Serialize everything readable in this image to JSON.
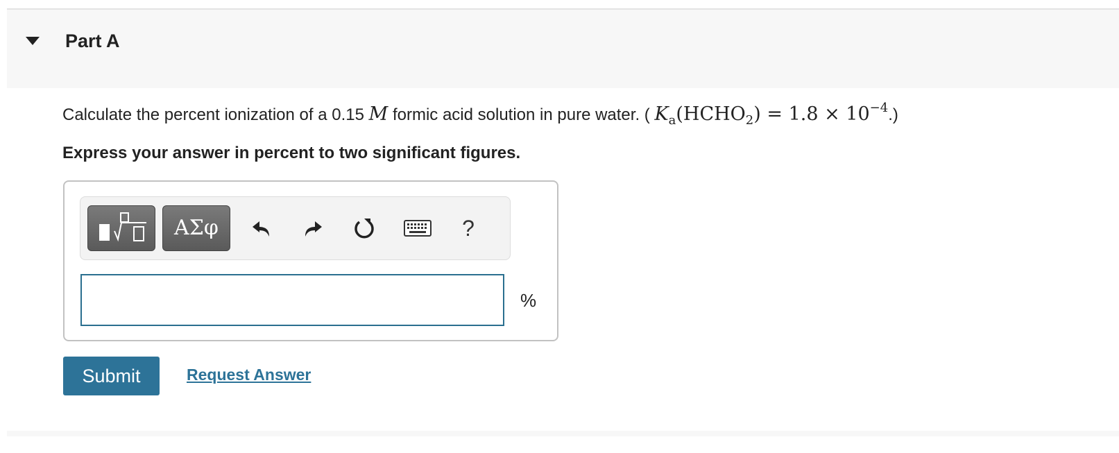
{
  "part": {
    "title": "Part A",
    "expanded": true
  },
  "question": {
    "text_before": "Calculate the percent ionization of a 0.15 ",
    "molarity_symbol": "M",
    "text_after": " formic acid solution in pure water. ( ",
    "ka_symbol": "K",
    "ka_subscript": "a",
    "ka_formula_open": "(HCHO",
    "ka_formula_sub": "2",
    "ka_formula_close": ")",
    "ka_value": " = 1.8 × 10",
    "ka_exponent": "−4",
    "close": ".)"
  },
  "instruction": "Express your answer in percent to two significant figures.",
  "toolbar": {
    "templates_icon": "templates-icon",
    "symbols_label": "ΑΣφ",
    "undo_icon": "undo-icon",
    "redo_icon": "redo-icon",
    "reset_icon": "reset-icon",
    "keyboard_icon": "keyboard-icon",
    "help_label": "?"
  },
  "answer": {
    "value": "",
    "unit": "%"
  },
  "actions": {
    "submit_label": "Submit",
    "request_answer_label": "Request Answer"
  },
  "colors": {
    "accent": "#2d7398",
    "header_bg": "#f7f7f7",
    "input_border": "#2a6f8f"
  }
}
